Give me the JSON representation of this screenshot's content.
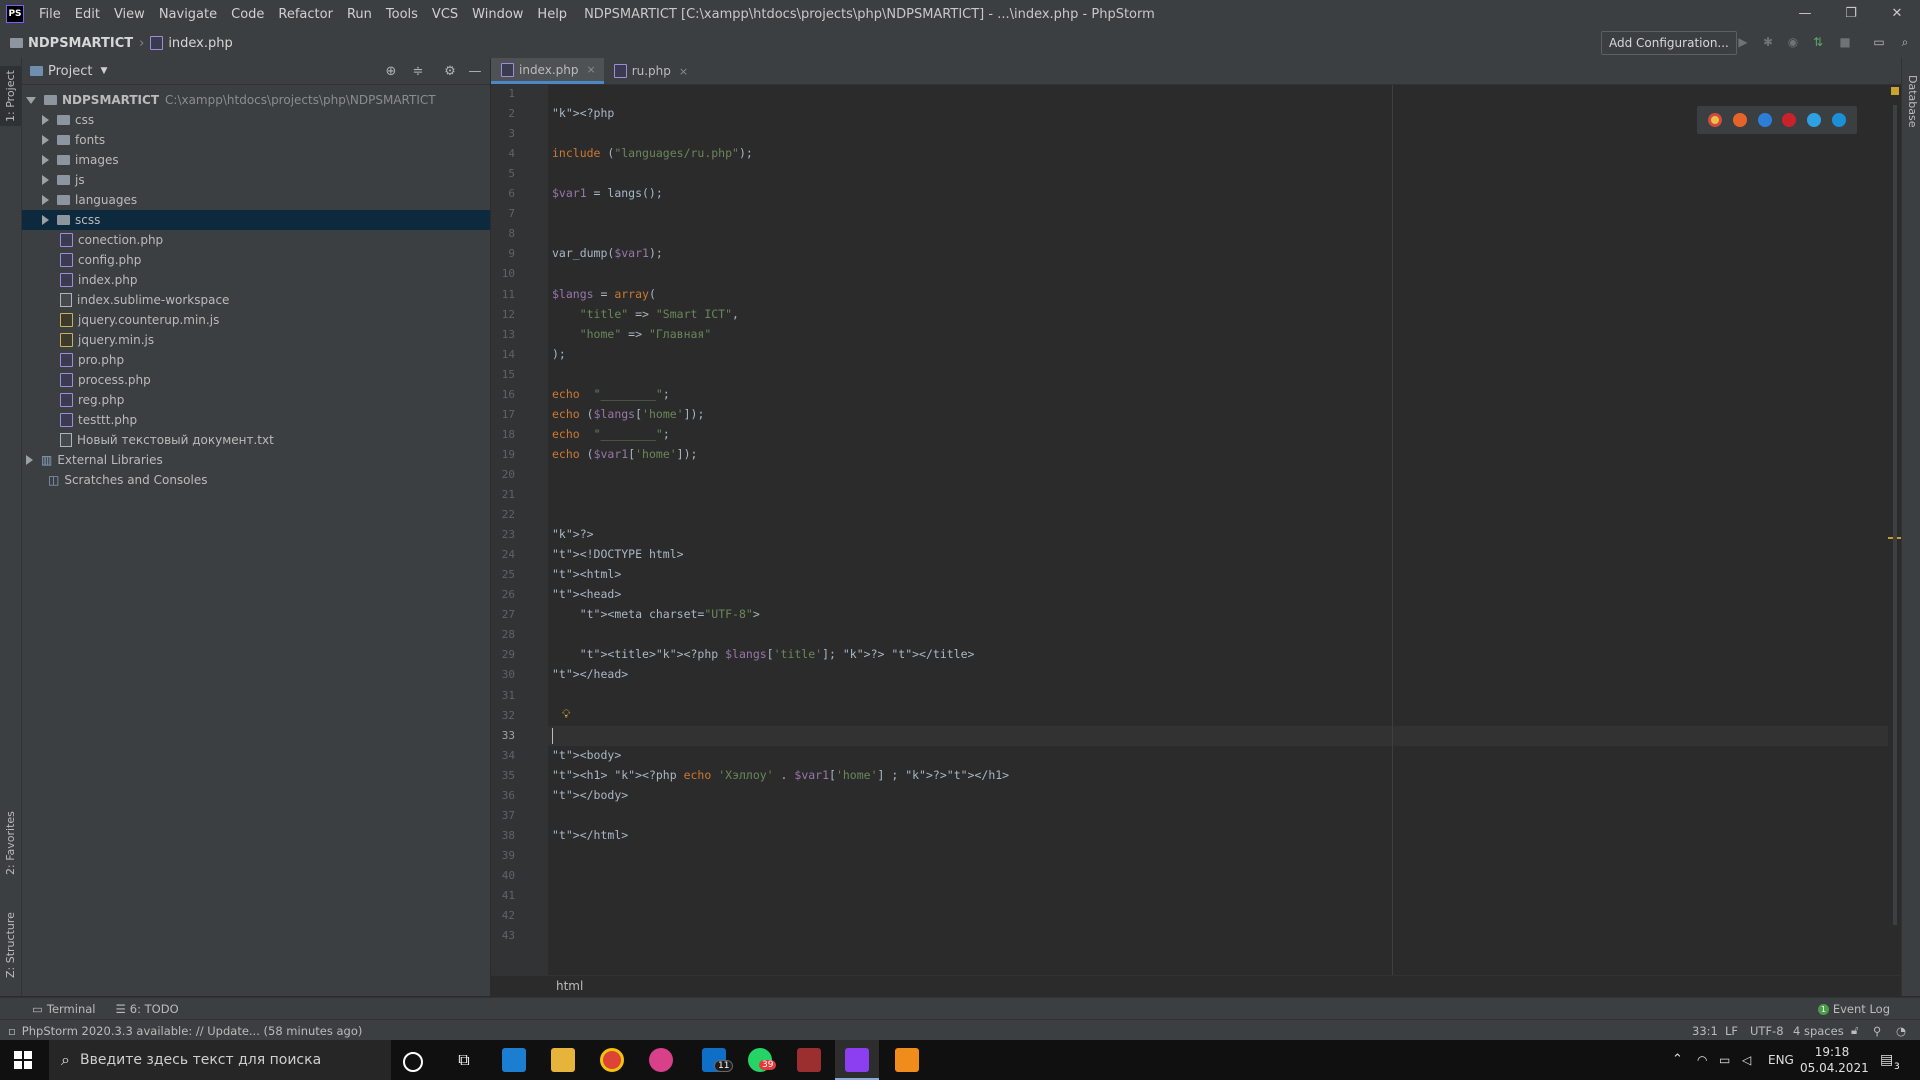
{
  "app": {
    "logo": "PS",
    "window_title": "NDPSMARTICT [C:\\xampp\\htdocs\\projects\\php\\NDPSMARTICT] - ...\\index.php - PhpStorm",
    "menu": [
      "File",
      "Edit",
      "View",
      "Navigate",
      "Code",
      "Refactor",
      "Run",
      "Tools",
      "VCS",
      "Window",
      "Help"
    ],
    "win_controls": {
      "minimize": "—",
      "restore": "❐",
      "close": "✕"
    }
  },
  "navbar": {
    "project": "NDPSMARTICT",
    "file": "index.php",
    "add_configuration": "Add Configuration..."
  },
  "left_strip": {
    "project_tab": "1: Project",
    "favorites_tab": "2: Favorites",
    "structure_tab": "Z: Structure"
  },
  "right_strip": {
    "database_tab": "Database"
  },
  "project_panel": {
    "title": "Project",
    "root": {
      "name": "NDPSMARTICT",
      "path": "C:\\xampp\\htdocs\\projects\\php\\NDPSMARTICT"
    },
    "folders": [
      "css",
      "fonts",
      "images",
      "js",
      "languages",
      "scss"
    ],
    "selected": "scss",
    "files": [
      {
        "name": "conection.php",
        "type": "php"
      },
      {
        "name": "config.php",
        "type": "php"
      },
      {
        "name": "index.php",
        "type": "php"
      },
      {
        "name": "index.sublime-workspace",
        "type": "txt"
      },
      {
        "name": "jquery.counterup.min.js",
        "type": "js"
      },
      {
        "name": "jquery.min.js",
        "type": "js"
      },
      {
        "name": "pro.php",
        "type": "php"
      },
      {
        "name": "process.php",
        "type": "php"
      },
      {
        "name": "reg.php",
        "type": "php"
      },
      {
        "name": "testtt.php",
        "type": "php"
      },
      {
        "name": "Новый текстовый документ.txt",
        "type": "txt"
      }
    ],
    "external_libraries": "External Libraries",
    "scratches": "Scratches and Consoles"
  },
  "editor": {
    "tabs": [
      {
        "label": "index.php",
        "close": "×",
        "active": true
      },
      {
        "label": "ru.php",
        "close": "×",
        "active": false
      }
    ],
    "current_line": 33,
    "line_count": 43,
    "breadcrumb": "html",
    "lines": [
      "",
      "<?php",
      "",
      "include (\"languages/ru.php\");",
      "",
      "$var1 = langs();",
      "",
      "",
      "var_dump($var1);",
      "",
      "$langs = array(",
      "    \"title\" => \"Smart ICT\",",
      "    \"home\" => \"Главная\"",
      ");",
      "",
      "echo  \"________\";",
      "echo ($langs['home']);",
      "echo  \"________\";",
      "echo ($var1['home']);",
      "",
      "",
      "",
      "?>",
      "<!DOCTYPE html>",
      "<html>",
      "<head>",
      "    <meta charset=\"UTF-8\">",
      "",
      "    <title><?php $langs['title']; ?> </title>",
      "</head>",
      "",
      "",
      "",
      "<body>",
      "<h1> <?php echo 'Хэллоу' . $var1['home'] ; ?></h1>",
      "</body>",
      "",
      "</html>",
      "",
      "",
      "",
      "",
      ""
    ]
  },
  "bottom_tools": {
    "terminal": "Terminal",
    "todo": "6: TODO",
    "event_log": "Event Log",
    "event_count": "1"
  },
  "status": {
    "message": "PhpStorm 2020.3.3 available: // Update... (58 minutes ago)",
    "position": "33:1",
    "line_sep": "LF",
    "encoding": "UTF-8",
    "indent": "4 spaces"
  },
  "taskbar": {
    "search_placeholder": "Введите здесь текст для поиска",
    "outlook_badge": "11",
    "whatsapp_badge": "39",
    "lang": "ENG",
    "time": "19:18",
    "date": "05.04.2021",
    "notifications": "3"
  }
}
